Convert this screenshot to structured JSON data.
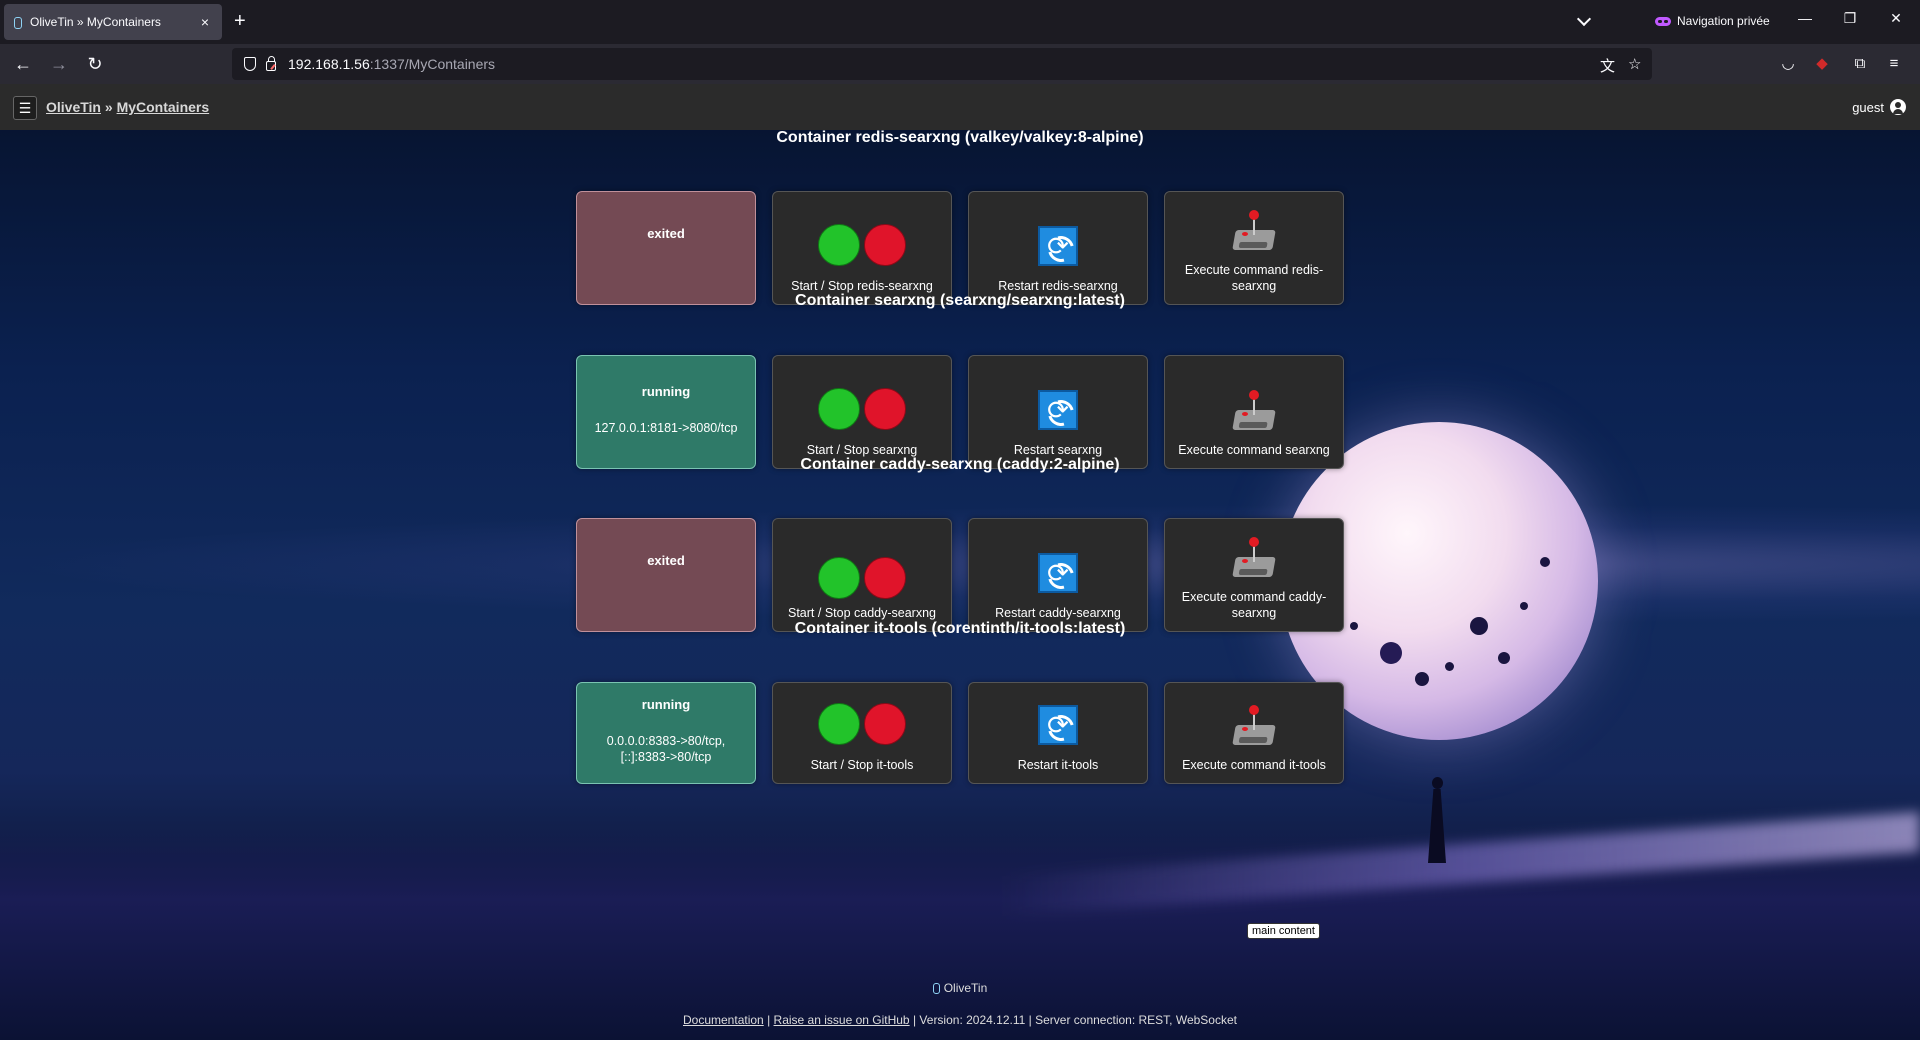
{
  "browser": {
    "tab_title": "OliveTin » MyContainers",
    "tab_close": "×",
    "new_tab": "+",
    "private_label": "Navigation privée",
    "url_host": "192.168.1.56",
    "url_rest": ":1337/MyContainers",
    "icons": [
      "back-arrow-icon",
      "forward-arrow-icon",
      "reload-icon",
      "shield-icon",
      "lock-icon",
      "translate-icon",
      "bookmark-star-icon",
      "pocket-icon",
      "extension-icon",
      "menu-icon"
    ]
  },
  "app": {
    "menu_icon": "☰",
    "breadcrumb": {
      "root": "OliveTin",
      "separator": "»",
      "page": "MyContainers"
    },
    "user": "guest"
  },
  "containers": [
    {
      "title": "Container redis-searxng (valkey/valkey:8-alpine)",
      "status": "exited",
      "ports": "",
      "start_stop": "Start / Stop redis-searxng",
      "restart": "Restart redis-searxng",
      "execute": "Execute command redis-searxng"
    },
    {
      "title": "Container searxng (searxng/searxng:latest)",
      "status": "running",
      "ports": "127.0.0.1:8181->8080/tcp",
      "start_stop": "Start / Stop searxng",
      "restart": "Restart searxng",
      "execute": "Execute command searxng"
    },
    {
      "title": "Container caddy-searxng (caddy:2-alpine)",
      "status": "exited",
      "ports": "",
      "start_stop": "Start / Stop caddy-searxng",
      "restart": "Restart caddy-searxng",
      "execute": "Execute command caddy-searxng"
    },
    {
      "title": "Container it-tools (corentinth/it-tools:latest)",
      "status": "running",
      "ports": "0.0.0.0:8383->80/tcp, [::]:8383->80/tcp",
      "start_stop": "Start / Stop it-tools",
      "restart": "Restart it-tools",
      "execute": "Execute command it-tools"
    }
  ],
  "tooltip": "main content",
  "footer": {
    "brand": "OliveTin",
    "documentation": "Documentation",
    "separator": "|",
    "issue": "Raise an issue on GitHub",
    "version": "Version: 2024.12.11",
    "server": "Server connection: REST, WebSocket"
  },
  "colors": {
    "exited": "#744a54",
    "running": "#2f7a68",
    "start": "#22c32a",
    "stop": "#e0142a",
    "restart": "#1f8ce0"
  }
}
